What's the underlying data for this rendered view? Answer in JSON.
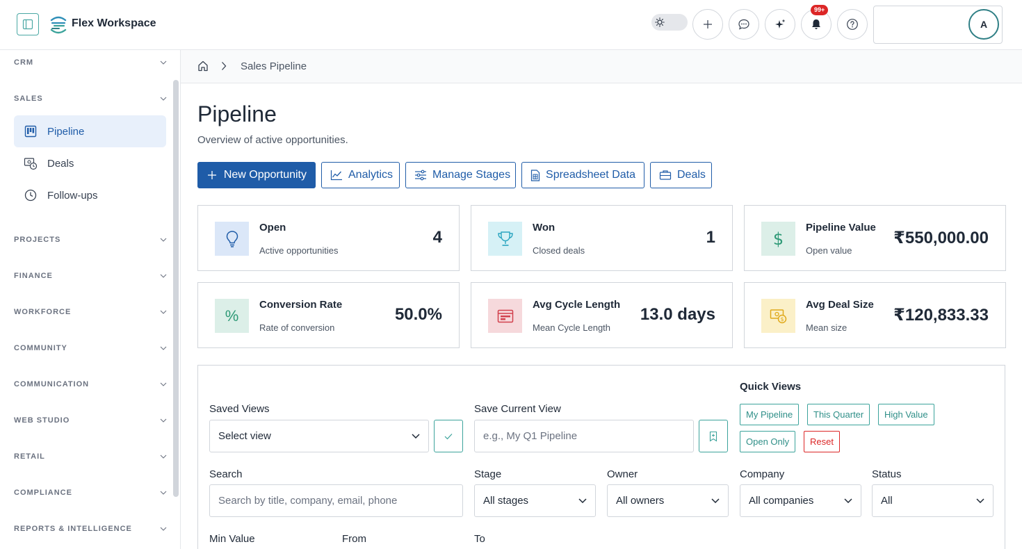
{
  "app": {
    "title": "Flex Workspace",
    "notifications_badge": "99+",
    "avatar_initial": "A"
  },
  "sidebar": {
    "sections": {
      "crm": "CRM",
      "sales": "SALES",
      "projects": "PROJECTS",
      "finance": "FINANCE",
      "workforce": "WORKFORCE",
      "community": "COMMUNITY",
      "communication": "COMMUNICATION",
      "web_studio": "WEB STUDIO",
      "retail": "RETAIL",
      "compliance": "COMPLIANCE",
      "reports": "REPORTS & INTELLIGENCE"
    },
    "sales_items": {
      "pipeline": "Pipeline",
      "deals": "Deals",
      "followups": "Follow-ups"
    }
  },
  "breadcrumb": {
    "current": "Sales Pipeline"
  },
  "page": {
    "title": "Pipeline",
    "subtitle": "Overview of active opportunities."
  },
  "actions": {
    "new_opportunity": "New Opportunity",
    "analytics": "Analytics",
    "manage_stages": "Manage Stages",
    "spreadsheet": "Spreadsheet Data",
    "deals": "Deals"
  },
  "stats": {
    "open": {
      "title": "Open",
      "sub": "Active opportunities",
      "value": "4"
    },
    "won": {
      "title": "Won",
      "sub": "Closed deals",
      "value": "1"
    },
    "pipeline_value": {
      "title": "Pipeline Value",
      "sub": "Open value",
      "value": "₹550,000.00"
    },
    "conversion": {
      "title": "Conversion Rate",
      "sub": "Rate of conversion",
      "value": "50.0%"
    },
    "cycle": {
      "title": "Avg Cycle Length",
      "sub": "Mean Cycle Length",
      "value": "13.0 days"
    },
    "deal_size": {
      "title": "Avg Deal Size",
      "sub": "Mean size",
      "value": "₹120,833.33"
    }
  },
  "filters": {
    "saved_views_label": "Saved Views",
    "saved_views_value": "Select view",
    "save_current_label": "Save Current View",
    "save_current_placeholder": "e.g., My Q1 Pipeline",
    "quick_views_label": "Quick Views",
    "quick_views": {
      "my_pipeline": "My Pipeline",
      "this_quarter": "This Quarter",
      "high_value": "High Value",
      "open_only": "Open Only",
      "reset": "Reset"
    },
    "search_label": "Search",
    "search_placeholder": "Search by title, company, email, phone",
    "stage_label": "Stage",
    "stage_value": "All stages",
    "owner_label": "Owner",
    "owner_value": "All owners",
    "company_label": "Company",
    "company_value": "All companies",
    "status_label": "Status",
    "status_value": "All",
    "min_value_label": "Min Value",
    "from_label": "From",
    "to_label": "To"
  },
  "colors": {
    "primary": "#1f5ca8",
    "teal": "#3ba39b",
    "danger": "#dc2626",
    "active_nav_bg": "#e8f0fb"
  },
  "icons": {
    "sidebar_toggle": "sidebar-toggle-icon",
    "theme": "sun-icon",
    "add": "plus-icon",
    "chat": "chat-icon",
    "ai": "sparkle-icon",
    "notifications": "bell-icon",
    "help": "help-icon",
    "home": "home-icon",
    "open": "lightbulb-icon",
    "won": "trophy-icon",
    "pipeline_value": "dollar-icon",
    "conversion": "percent-icon",
    "cycle": "calendar-card-icon",
    "deal_size": "money-icon"
  }
}
